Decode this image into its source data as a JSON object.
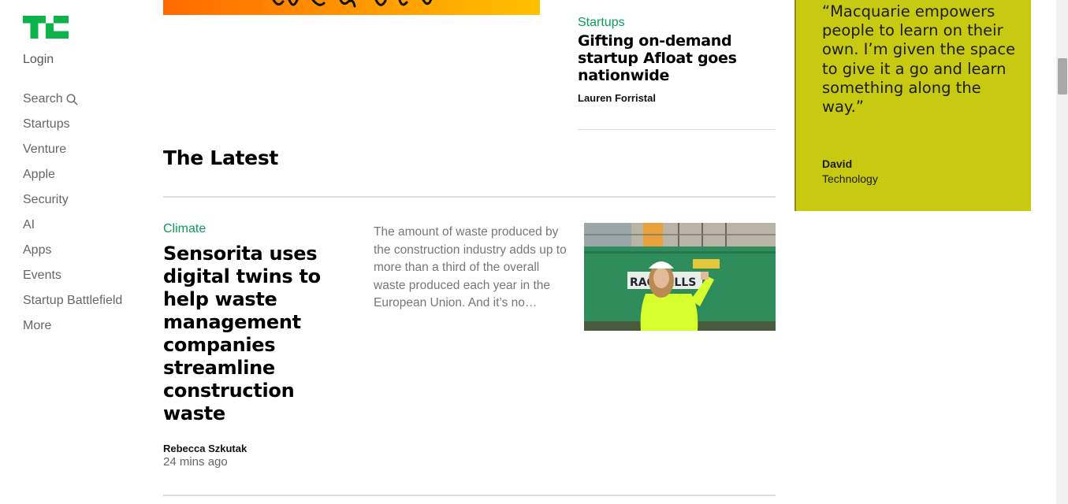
{
  "sidebar": {
    "login": "Login",
    "nav": [
      "Search",
      "Startups",
      "Venture",
      "Apple",
      "Security",
      "AI",
      "Apps",
      "Events",
      "Startup Battlefield",
      "More"
    ]
  },
  "side_article": {
    "category": "Startups",
    "title": "Gifting on-demand startup Afloat goes nationwide",
    "author": "Lauren Forristal"
  },
  "latest": {
    "heading": "The Latest",
    "article": {
      "category": "Climate",
      "title": "Sensorita uses digital twins to help waste management companies streamline construction waste",
      "excerpt": "The amount of waste produced by the construction industry adds up to more than a third of the overall waste produced each year in the European Union. And it’s no…",
      "author": "Rebecca Szkutak",
      "time": "24 mins ago",
      "thumbnail_sign": "RAC SELLS"
    }
  },
  "ad": {
    "quote": "“Macquarie empowers people to learn on their own. I’m given the space to give it a go and learn something along the way.”",
    "name": "David",
    "department": "Technology",
    "background_color": "#c8c911"
  },
  "colors": {
    "brand_green": "#0a9a5c",
    "logo_green": "#0bb34a"
  }
}
